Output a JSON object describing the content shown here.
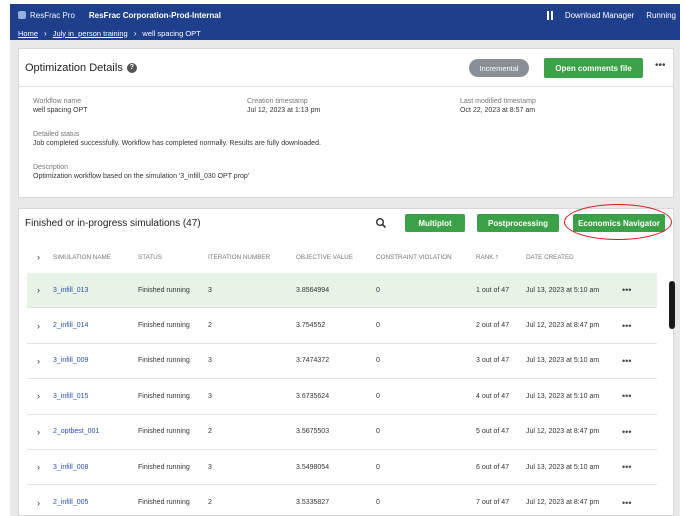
{
  "topbar": {
    "app_name": "ResFrac Pro",
    "org": "ResFrac Corporation-Prod-Internal",
    "download_manager": "Download Manager",
    "running": "Running"
  },
  "breadcrumb": {
    "home": "Home",
    "folder": "July in_person training",
    "current": "well spacing OPT"
  },
  "details": {
    "title": "Optimization Details",
    "status_pill": "Incremental",
    "open_comments": "Open comments file",
    "more": "•••",
    "workflow_name_label": "Workflow name",
    "workflow_name": "well spacing OPT",
    "creation_label": "Creation timestamp",
    "creation": "Jul 12, 2023 at 1:13 pm",
    "modified_label": "Last modified timestamp",
    "modified": "Oct 22, 2023 at 8:57 am",
    "detailed_status_label": "Detailed status",
    "detailed_status": "Job completed successfully. Workflow has completed normally. Results are fully downloaded.",
    "description_label": "Description",
    "description": "Optimization workflow based on the simulation '3_infill_030 OPT prop'"
  },
  "simulations": {
    "title": "Finished or in-progress simulations (47)",
    "multiplot": "Multiplot",
    "postprocessing": "Postprocessing",
    "economics_navigator": "Economics Navigator",
    "columns": [
      "SIMULATION NAME",
      "STATUS",
      "ITERATION NUMBER",
      "OBJECTIVE VALUE",
      "CONSTRAINT VIOLATION",
      "RANK",
      "DATE CREATED"
    ],
    "rows": [
      {
        "name": "3_infill_013",
        "status": "Finished running",
        "iteration": "3",
        "objective": "3.8564994",
        "violation": "0",
        "rank": "1 out of 47",
        "date": "Jul 13, 2023 at 5:10 am"
      },
      {
        "name": "2_infill_014",
        "status": "Finished running",
        "iteration": "2",
        "objective": "3.754552",
        "violation": "0",
        "rank": "2 out of 47",
        "date": "Jul 12, 2023 at 8:47 pm"
      },
      {
        "name": "3_infill_009",
        "status": "Finished running",
        "iteration": "3",
        "objective": "3.7474372",
        "violation": "0",
        "rank": "3 out of 47",
        "date": "Jul 13, 2023 at 5:10 am"
      },
      {
        "name": "3_infill_015",
        "status": "Finished running",
        "iteration": "3",
        "objective": "3.6735624",
        "violation": "0",
        "rank": "4 out of 47",
        "date": "Jul 13, 2023 at 5:10 am"
      },
      {
        "name": "2_optbest_001",
        "status": "Finished running",
        "iteration": "2",
        "objective": "3.5675503",
        "violation": "0",
        "rank": "5 out of 47",
        "date": "Jul 12, 2023 at 8:47 pm"
      },
      {
        "name": "3_infill_008",
        "status": "Finished running",
        "iteration": "3",
        "objective": "3.5498054",
        "violation": "0",
        "rank": "6 out of 47",
        "date": "Jul 13, 2023 at 5:10 am"
      },
      {
        "name": "2_infill_005",
        "status": "Finished running",
        "iteration": "2",
        "objective": "3.5335827",
        "violation": "0",
        "rank": "7 out of 47",
        "date": "Jul 12, 2023 at 8:47 pm"
      }
    ],
    "row_more": "•••"
  },
  "colors": {
    "topbar": "#1e3f8c",
    "green_button": "#3aa147",
    "highlight_row": "#e6f3e6",
    "annotation_circle": "#d11a1a"
  }
}
